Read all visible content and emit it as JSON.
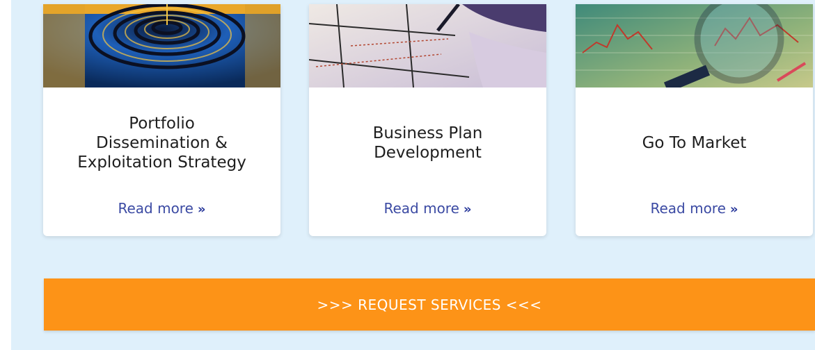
{
  "cards": [
    {
      "image_name": "water-ripple-image",
      "title": "Portfolio\nDissemination &\nExploitation Strategy",
      "read_more": "Read more"
    },
    {
      "image_name": "business-plan-sketch-image",
      "title": "Business Plan\nDevelopment",
      "read_more": "Read more"
    },
    {
      "image_name": "magnifier-chart-image",
      "title": "Go To Market",
      "read_more": "Read more"
    }
  ],
  "read_more_icon": "double-chevron-right-icon",
  "cta": {
    "label": ">>> REQUEST SERVICES <<<"
  },
  "colors": {
    "background": "#dff0fb",
    "accent": "#fd9317",
    "link": "#3b4aa3",
    "text": "#1e1e1e"
  }
}
